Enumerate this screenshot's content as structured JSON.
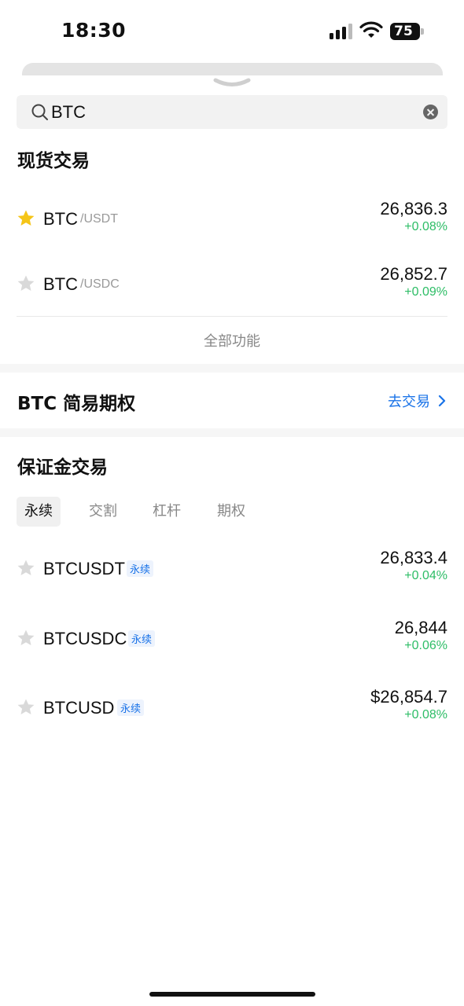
{
  "status_bar": {
    "time": "18:30",
    "battery": "75"
  },
  "search": {
    "value": "BTC"
  },
  "spot": {
    "title": "现货交易",
    "rows": [
      {
        "base": "BTC",
        "quote": "/USDT",
        "price": "26,836.3",
        "change": "+0.08%",
        "favorite": true
      },
      {
        "base": "BTC",
        "quote": "/USDC",
        "price": "26,852.7",
        "change": "+0.09%",
        "favorite": false
      }
    ],
    "all_features": "全部功能"
  },
  "options": {
    "title": "BTC 简易期权",
    "link": "去交易"
  },
  "margin": {
    "title": "保证金交易",
    "tabs": [
      "永续",
      "交割",
      "杠杆",
      "期权"
    ],
    "active_tab": "永续",
    "rows": [
      {
        "name": "BTCUSDT",
        "tag": "永续",
        "price": "26,833.4",
        "change": "+0.04%"
      },
      {
        "name": "BTCUSDC",
        "tag": "永续",
        "price": "26,844",
        "change": "+0.06%"
      },
      {
        "name": "BTCUSD",
        "tag": "永续",
        "price": "$26,854.7",
        "change": "+0.08%"
      }
    ]
  },
  "colors": {
    "positive": "#2dbd66",
    "link": "#1a73e8",
    "favorite_star": "#f5c518",
    "inactive_star": "#d9d9d9"
  }
}
